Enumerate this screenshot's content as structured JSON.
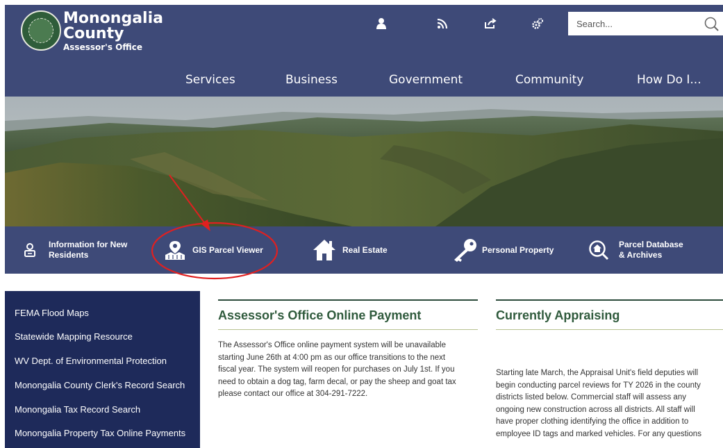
{
  "site": {
    "name_line1": "Monongalia",
    "name_line2": "County",
    "name_line3": "Assessor's Office"
  },
  "header_icons": [
    "user-icon",
    "rss-icon",
    "share-icon",
    "settings-icon"
  ],
  "search": {
    "placeholder": "Search..."
  },
  "nav": {
    "items": [
      {
        "label": "Services"
      },
      {
        "label": "Business"
      },
      {
        "label": "Government"
      },
      {
        "label": "Community"
      },
      {
        "label": "How Do I..."
      }
    ]
  },
  "quick_links": [
    {
      "label1": "Information for New",
      "label2": "Residents",
      "icon": "person-icon"
    },
    {
      "label1": "GIS Parcel Viewer",
      "label2": "",
      "icon": "map-pin-icon"
    },
    {
      "label1": "Real Estate",
      "label2": "",
      "icon": "house-icon"
    },
    {
      "label1": "Personal Property",
      "label2": "",
      "icon": "key-icon"
    },
    {
      "label1": "Parcel Database",
      "label2": "& Archives",
      "icon": "search-house-icon"
    }
  ],
  "sidebar": {
    "items": [
      {
        "label": "FEMA Flood Maps"
      },
      {
        "label": "Statewide Mapping Resource"
      },
      {
        "label": "WV Dept. of Environmental Protection"
      },
      {
        "label": "Monongalia County Clerk's Record Search"
      },
      {
        "label": "Monongalia Tax Record Search"
      },
      {
        "label": "Monongalia Property Tax Online Payments"
      }
    ]
  },
  "articles": {
    "payment": {
      "title": "Assessor's Office Online Payment",
      "lines": [
        "The Assessor's Office online payment system will be unavailable",
        "starting June 26th at 4:00 pm as our office transitions to the next",
        "fiscal year. The system will reopen for purchases on July 1st. If you",
        "need to obtain a dog tag, farm decal, or pay the sheep and goat tax",
        "please contact our office at 304-291-7222."
      ]
    },
    "appraising": {
      "title": "Currently Appraising",
      "lines": [
        "Starting late March, the Appraisal Unit's field deputies will",
        "begin conducting parcel reviews for TY 2026 in the county",
        "districts listed below. Commercial staff will assess any",
        "ongoing new construction across all districts. All staff will",
        "have proper clothing identifying the office in addition to",
        "employee ID tags and marked vehicles. For any questions"
      ]
    }
  },
  "colors": {
    "header_bg": "#3e4a78",
    "sidebar_bg": "#1e2a5a",
    "heading_green": "#2f5a3c",
    "annotation_red": "#e02020"
  }
}
